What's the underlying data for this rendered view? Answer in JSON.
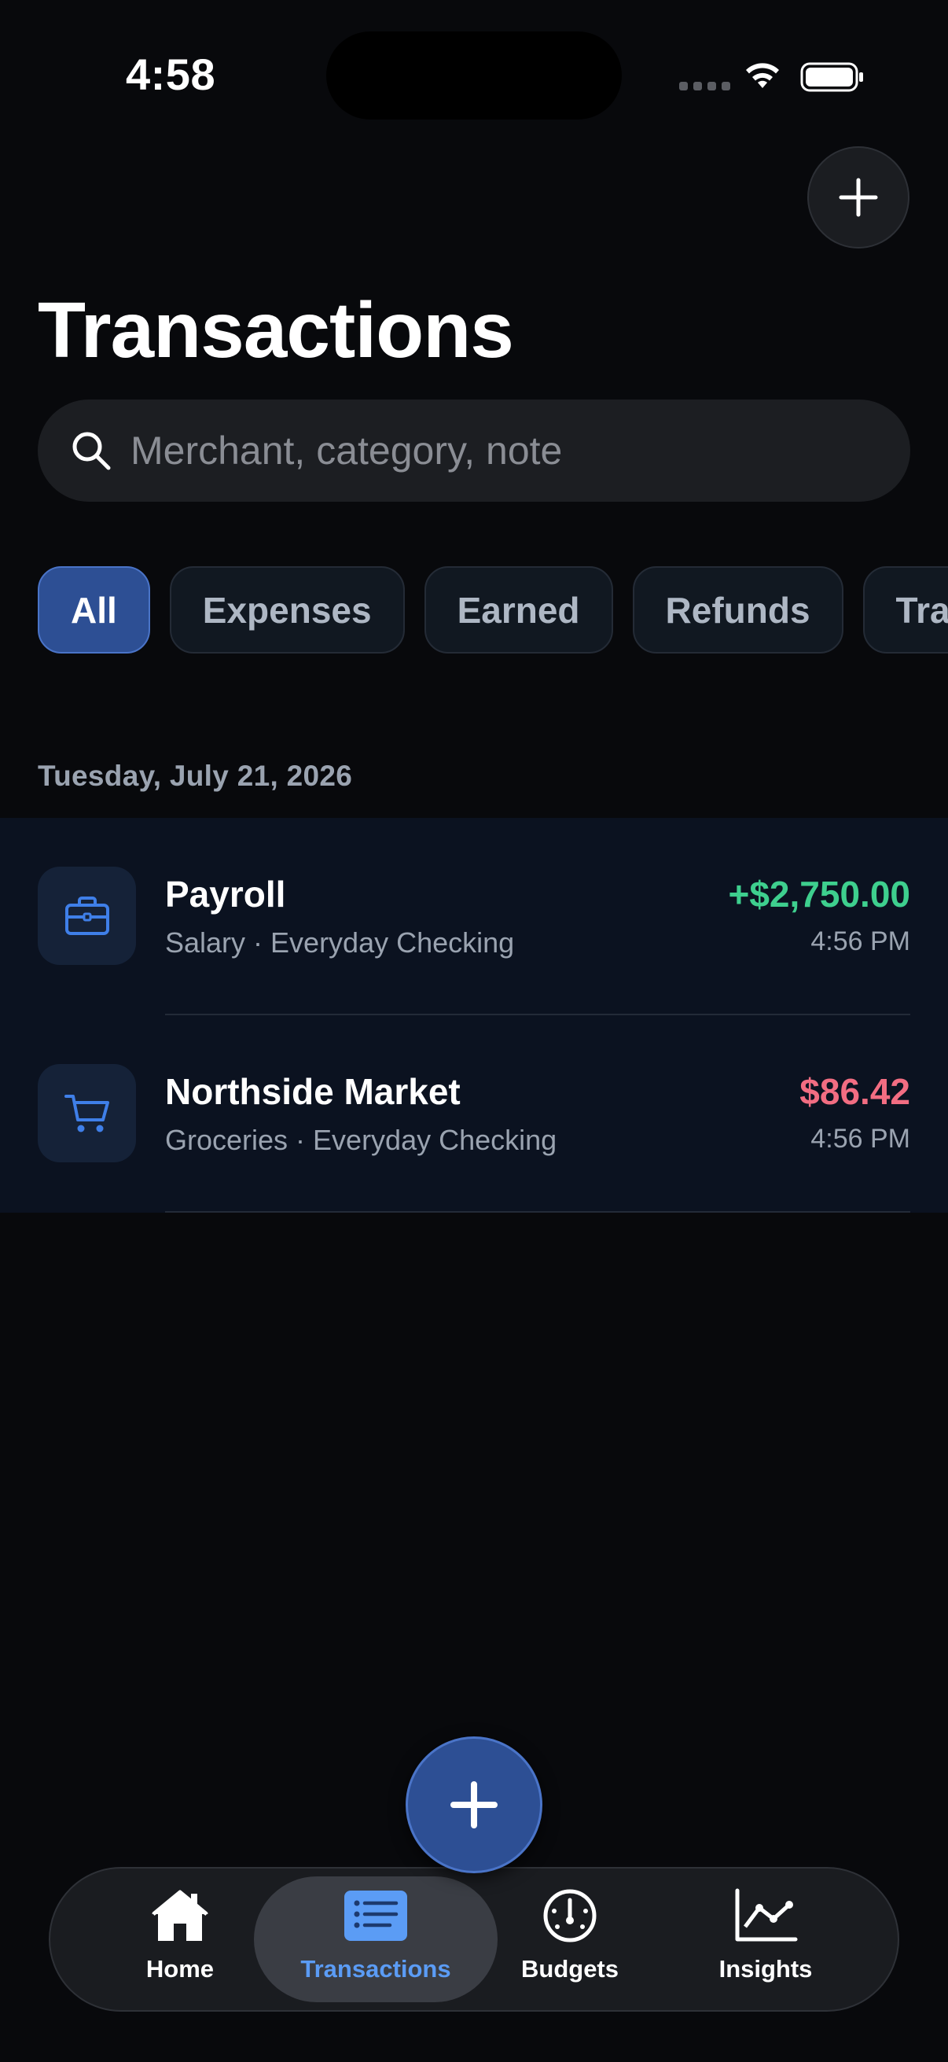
{
  "status_bar": {
    "time": "4:58"
  },
  "header": {
    "title": "Transactions"
  },
  "search": {
    "placeholder": "Merchant, category, note"
  },
  "filters": [
    {
      "label": "All",
      "active": true
    },
    {
      "label": "Expenses",
      "active": false
    },
    {
      "label": "Earned",
      "active": false
    },
    {
      "label": "Refunds",
      "active": false
    },
    {
      "label": "Tran",
      "active": false
    }
  ],
  "sections": [
    {
      "date": "Tuesday, July 21, 2026",
      "transactions": [
        {
          "icon": "briefcase-icon",
          "name": "Payroll",
          "subtitle": "Salary · Everyday Checking",
          "amount": "+$2,750.00",
          "amount_color": "#3ecf8e",
          "time": "4:56 PM"
        },
        {
          "icon": "cart-icon",
          "name": "Northside Market",
          "subtitle": "Groceries · Everyday Checking",
          "amount": "$86.42",
          "amount_color": "#f26d82",
          "time": "4:56 PM"
        }
      ]
    }
  ],
  "tabs": [
    {
      "label": "Home",
      "icon": "house-icon",
      "active": false
    },
    {
      "label": "Transactions",
      "icon": "list-icon",
      "active": true
    },
    {
      "label": "Budgets",
      "icon": "gauge-icon",
      "active": false
    },
    {
      "label": "Insights",
      "icon": "chart-icon",
      "active": false
    }
  ],
  "colors": {
    "accent": "#2d4f94",
    "active_tab": "#5b9cf5",
    "income": "#3ecf8e",
    "expense": "#f26d82"
  }
}
